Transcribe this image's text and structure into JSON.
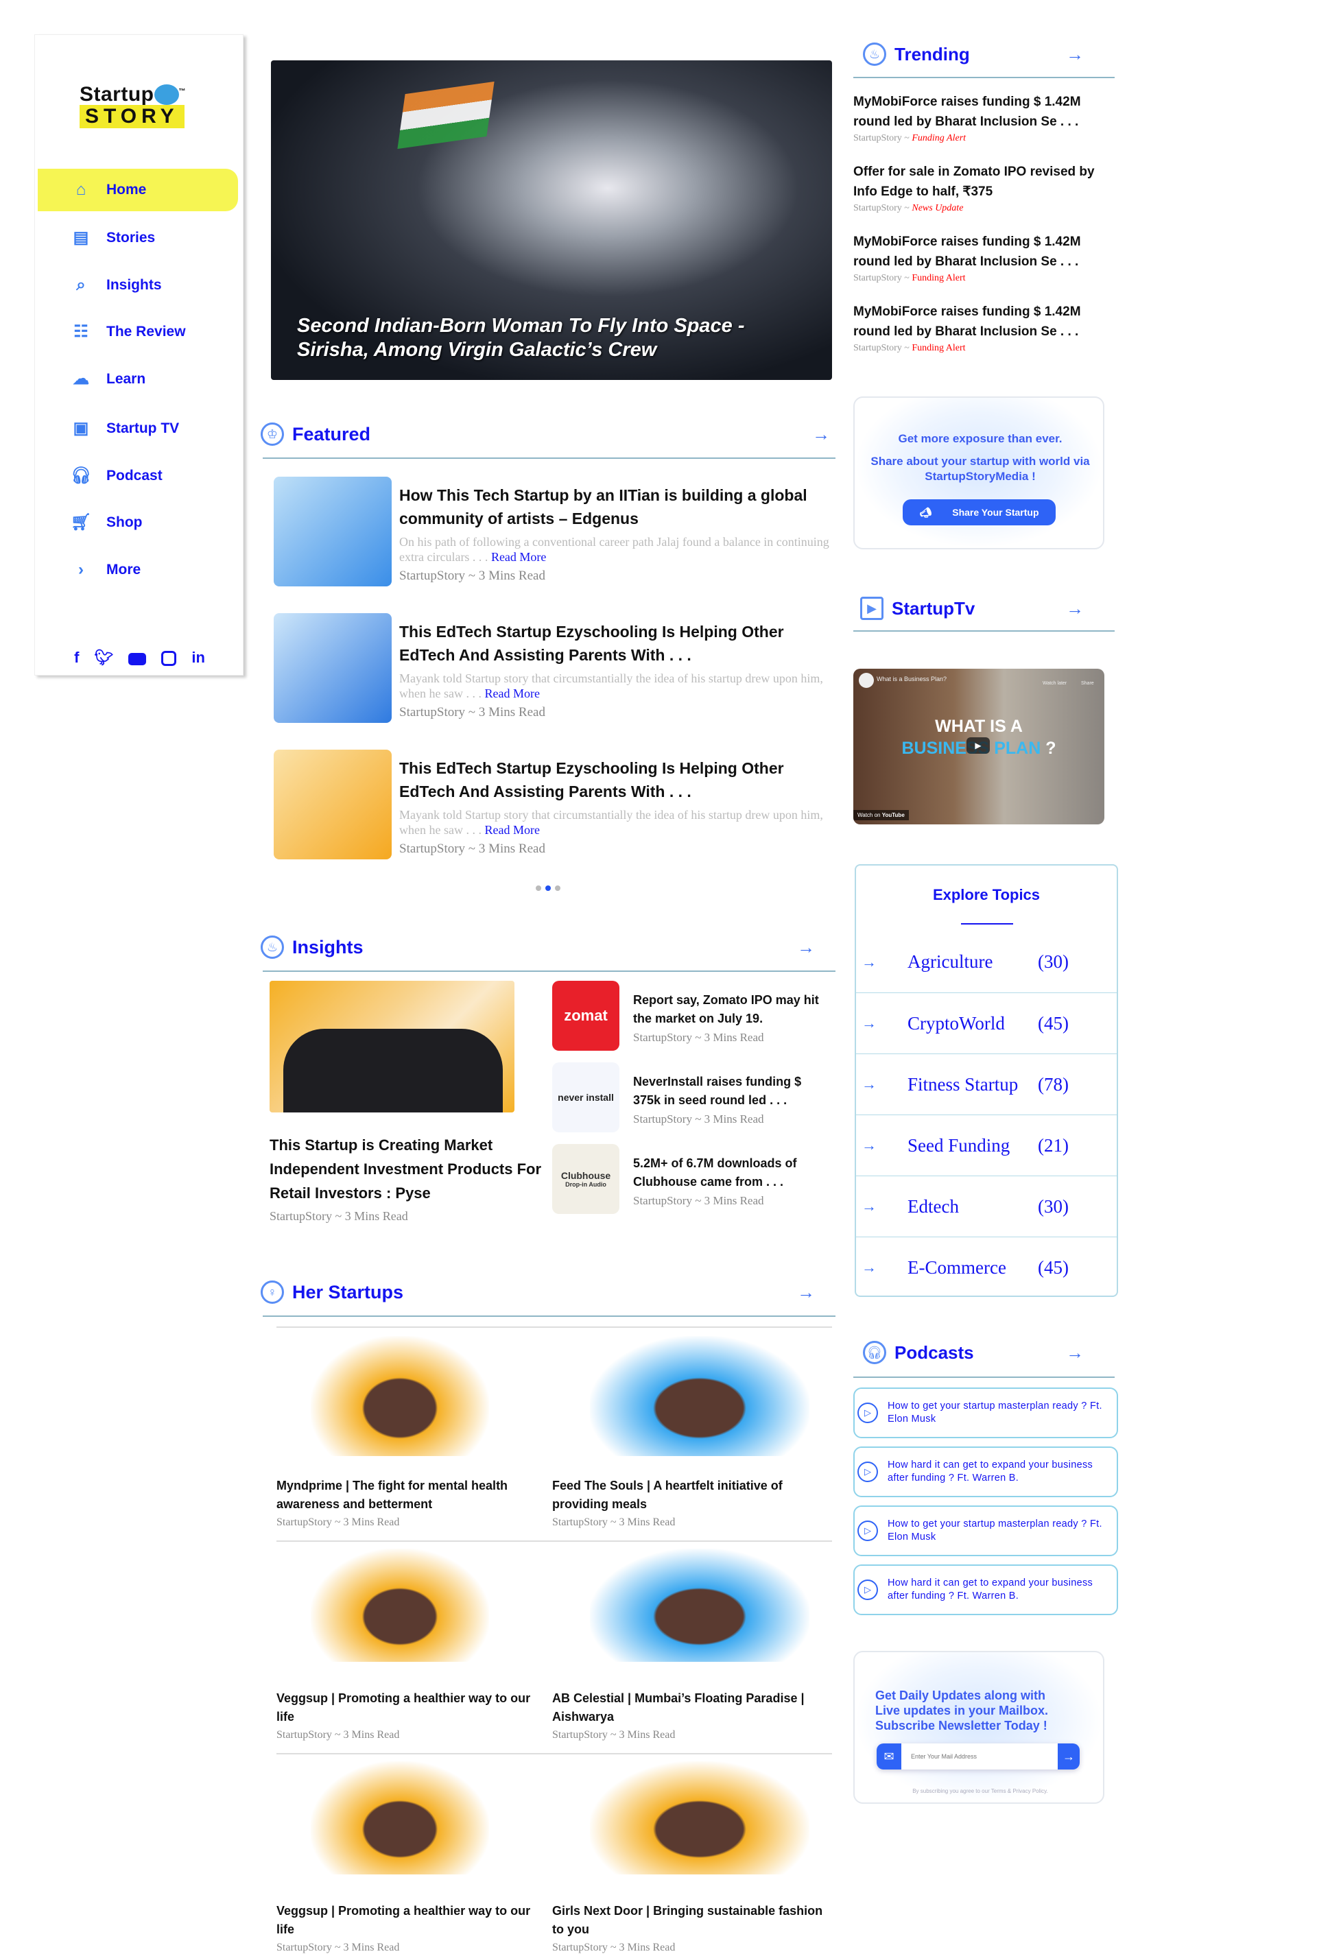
{
  "brand": {
    "line1": "Startup",
    "line2": "STORY",
    "tm": "™"
  },
  "sidebar": {
    "items": [
      {
        "label": "Home",
        "icon": "home-icon",
        "active": true
      },
      {
        "label": "Stories",
        "icon": "book-icon"
      },
      {
        "label": "Insights",
        "icon": "globe-search-icon"
      },
      {
        "label": "The Review",
        "icon": "clipboard-icon"
      },
      {
        "label": "Learn",
        "icon": "book-brain-icon"
      },
      {
        "label": "Startup TV",
        "icon": "tv-icon"
      },
      {
        "label": "Podcast",
        "icon": "headset-icon"
      },
      {
        "label": "Shop",
        "icon": "cart-icon"
      },
      {
        "label": "More",
        "icon": "chevron-right-circle-icon"
      }
    ],
    "social": [
      "facebook-icon",
      "twitter-icon",
      "youtube-icon",
      "instagram-icon",
      "linkedin-icon"
    ]
  },
  "hero": {
    "title": "Second Indian-Born Woman To Fly Into Space - Sirisha,  Among Virgin Galactic’s Crew"
  },
  "featured": {
    "title": "Featured",
    "items": [
      {
        "title": "How This Tech Startup by an IITian is building a global community of artists – Edgenus",
        "excerpt": "On his path of following a conventional career path Jalaj found a balance in continuing extra circulars . . .",
        "read_more": "Read More",
        "meta": "StartupStory ~ 3 Mins Read"
      },
      {
        "title": "This EdTech Startup Ezyschooling Is Helping Other EdTech And Assisting Parents With . . .",
        "excerpt": "Mayank told Startup story that circumstantially the idea of his startup drew upon him, when he saw . . .",
        "read_more": "Read More",
        "meta": "StartupStory ~ 3 Mins Read"
      },
      {
        "title": "This EdTech Startup Ezyschooling Is Helping Other EdTech And Assisting Parents With . . .",
        "excerpt": "Mayank told Startup story that circumstantially the idea of his startup drew upon him, when he saw . . .",
        "read_more": "Read More",
        "meta": "StartupStory ~ 3 Mins Read"
      }
    ],
    "carousel_active": 2,
    "carousel_count": 3
  },
  "insights": {
    "title": "Insights",
    "main": {
      "title": "This Startup is Creating Market Independent Investment Products For Retail Investors : Pyse",
      "meta": "StartupStory ~ 3 Mins Read"
    },
    "items": [
      {
        "title": "Report say, Zomato IPO may hit the market on July 19.",
        "meta": "StartupStory ~ 3 Mins Read",
        "thumb_text": "zomat"
      },
      {
        "title": "NeverInstall raises funding $ 375k in seed round led . . .",
        "meta": "StartupStory ~ 3 Mins Read",
        "thumb_text": "never install"
      },
      {
        "title": "5.2M+ of 6.7M downloads of Clubhouse came from . . .",
        "meta": "StartupStory ~ 3 Mins Read",
        "thumb_text": "Clubhouse",
        "thumb_sub": "Drop-in Audio"
      }
    ]
  },
  "her_startups": {
    "title": "Her Startups",
    "items": [
      {
        "title": "Myndprime | The fight for mental health awareness and betterment",
        "meta": "StartupStory ~ 3 Mins Read"
      },
      {
        "title": "Feed The Souls | A heartfelt initiative of providing meals",
        "meta": "StartupStory ~ 3 Mins Read"
      },
      {
        "title": "Veggsup | Promoting a healthier way to our life",
        "meta": "StartupStory ~ 3 Mins Read"
      },
      {
        "title": "AB Celestial | Mumbai’s Floating Paradise | Aishwarya",
        "meta": "StartupStory ~ 3 Mins Read"
      },
      {
        "title": "Veggsup | Promoting a healthier way to our life",
        "meta": "StartupStory ~ 3 Mins Read"
      },
      {
        "title": "Girls Next Door | Bringing sustainable fashion to you",
        "meta": "StartupStory ~ 3 Mins Read"
      }
    ]
  },
  "trending": {
    "title": "Trending",
    "items": [
      {
        "title": "MyMobiForce raises funding $ 1.42M round led by Bharat Inclusion Se . . .",
        "source": "StartupStory ~ ",
        "tag": "Funding Alert"
      },
      {
        "title": "Offer for sale in Zomato IPO revised by Info Edge to half, ₹375",
        "source": "StartupStory ~ ",
        "tag": "News Update"
      },
      {
        "title": "MyMobiForce raises funding $ 1.42M round led by Bharat Inclusion Se . . .",
        "source": "StartupStory ~ ",
        "tag": "Funding Alert"
      },
      {
        "title": "MyMobiForce raises funding $ 1.42M round led by Bharat Inclusion Se . . .",
        "source": "StartupStory ~ ",
        "tag": "Funding Alert"
      }
    ]
  },
  "share_banner": {
    "line1": "Get more exposure than ever.",
    "line2": "Share about your startup with world via StartupStoryMedia !",
    "button": "Share Your Startup"
  },
  "startup_tv": {
    "title": "StartupTv",
    "video": {
      "title": "What is a Business Plan?",
      "line1": "WHAT IS A",
      "line2": "BUSINESS PLAN",
      "q": "?",
      "watch_later": "Watch later",
      "share": "Share",
      "watch_on": "Watch on",
      "youtube": "YouTube"
    }
  },
  "explore": {
    "title": "Explore Topics",
    "topics": [
      {
        "name": "Agriculture",
        "count": "(30)"
      },
      {
        "name": "CryptoWorld",
        "count": "(45)"
      },
      {
        "name": "Fitness Startup",
        "count": "(78)"
      },
      {
        "name": "Seed Funding",
        "count": "(21)"
      },
      {
        "name": "Edtech",
        "count": "(30)"
      },
      {
        "name": "E-Commerce",
        "count": "(45)"
      }
    ]
  },
  "podcasts": {
    "title": "Podcasts",
    "items": [
      {
        "title": "How to get your startup masterplan ready ? Ft. Elon Musk"
      },
      {
        "title": "How hard it can get to expand your business after funding ? Ft. Warren B."
      },
      {
        "title": "How to get your startup masterplan ready ? Ft. Elon Musk"
      },
      {
        "title": "How hard it can get to expand your business after funding ? Ft. Warren B."
      }
    ]
  },
  "newsletter": {
    "line1": "Get Daily Updates along with",
    "line2": "Live updates in your Mailbox.",
    "line3": "Subscribe Newsletter Today !",
    "placeholder": "Enter Your Mail Address",
    "disclaimer": "By subscribing you agree to our Terms & Privacy Policy."
  },
  "colors": {
    "accent": "#1414f0",
    "button": "#2e63f6",
    "highlight": "#f6f553",
    "tag": "#ff0000"
  }
}
